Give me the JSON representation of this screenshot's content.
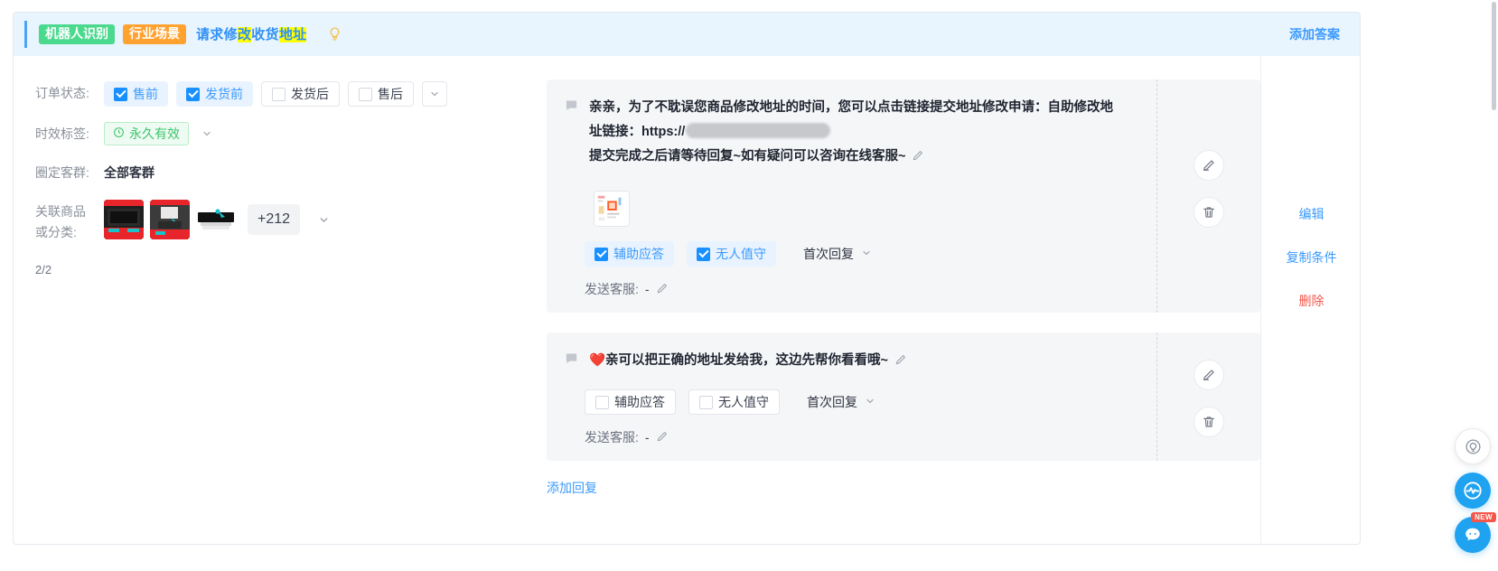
{
  "header": {
    "tag_robot": "机器人识别",
    "tag_scene": "行业场景",
    "title_parts": [
      {
        "text": "请求修",
        "highlight": false
      },
      {
        "text": "改",
        "highlight": true
      },
      {
        "text": "收货",
        "highlight": false
      },
      {
        "text": "地址",
        "highlight": true
      }
    ],
    "bulb_icon": "lightbulb-icon",
    "add_answer_label": "添加答案",
    "accent_color": "#4ba3f5",
    "bg_color": "#e8f4fe"
  },
  "filters": {
    "order_status": {
      "label": "订单状态:",
      "options": [
        {
          "label": "售前",
          "checked": true
        },
        {
          "label": "发货前",
          "checked": true
        },
        {
          "label": "发货后",
          "checked": false
        },
        {
          "label": "售后",
          "checked": false
        }
      ],
      "expand_icon": "chevron-down-icon"
    },
    "validity": {
      "label": "时效标签:",
      "value": "永久有效",
      "icon": "clock-icon",
      "color": "#3ec46d",
      "expand_icon": "chevron-down-icon"
    },
    "audience": {
      "label": "圈定客群:",
      "value": "全部客群"
    },
    "products": {
      "label_line1": "关联商品",
      "label_line2": "或分类:",
      "thumb_count": 3,
      "more_badge": "+212",
      "expand_icon": "chevron-down-icon"
    },
    "counter": "2/2"
  },
  "answers": [
    {
      "msg_icon": "message-bubble-icon",
      "lines": [
        "亲亲，为了不耽误您商品修改地址的时间，您可以点击链接提交地址修改申请：自助修改地",
        "址链接：https://",
        "提交完成之后请等待回复~如有疑问可以咨询在线客服~"
      ],
      "has_url_mask": true,
      "edit_inline_icon": "pencil-icon",
      "attachment_icon": "image-attachment-icon",
      "controls": [
        {
          "label": "辅助应答",
          "checked": true
        },
        {
          "label": "无人值守",
          "checked": true
        }
      ],
      "reply_timing": "首次回复",
      "reply_timing_icon": "chevron-down-icon",
      "send_agent_label": "发送客服:",
      "send_agent_value": "-",
      "send_agent_edit_icon": "pencil-icon",
      "edit_button_icon": "pencil-circle-icon",
      "delete_button_icon": "trash-circle-icon"
    },
    {
      "msg_icon": "message-bubble-icon",
      "lines": [
        "❤️亲可以把正确的地址发给我，这边先帮你看看哦~"
      ],
      "has_url_mask": false,
      "edit_inline_icon": "pencil-icon",
      "attachment_icon": null,
      "controls": [
        {
          "label": "辅助应答",
          "checked": false
        },
        {
          "label": "无人值守",
          "checked": false
        }
      ],
      "reply_timing": "首次回复",
      "reply_timing_icon": "chevron-down-icon",
      "send_agent_label": "发送客服:",
      "send_agent_value": "-",
      "send_agent_edit_icon": "pencil-icon",
      "edit_button_icon": "pencil-circle-icon",
      "delete_button_icon": "trash-circle-icon"
    }
  ],
  "add_reply_label": "添加回复",
  "row_actions": [
    {
      "label": "编辑",
      "color": "blue"
    },
    {
      "label": "复制条件",
      "color": "blue"
    },
    {
      "label": "删除",
      "color": "red"
    }
  ],
  "floating": [
    {
      "name": "help-bulb-button",
      "icon": "lightbulb-icon",
      "style": "white",
      "badge": null
    },
    {
      "name": "assistant-button",
      "icon": "pulse-chat-icon",
      "style": "blue",
      "badge": null
    },
    {
      "name": "chat-button",
      "icon": "chat-icon",
      "style": "blue",
      "badge": "NEW"
    }
  ]
}
